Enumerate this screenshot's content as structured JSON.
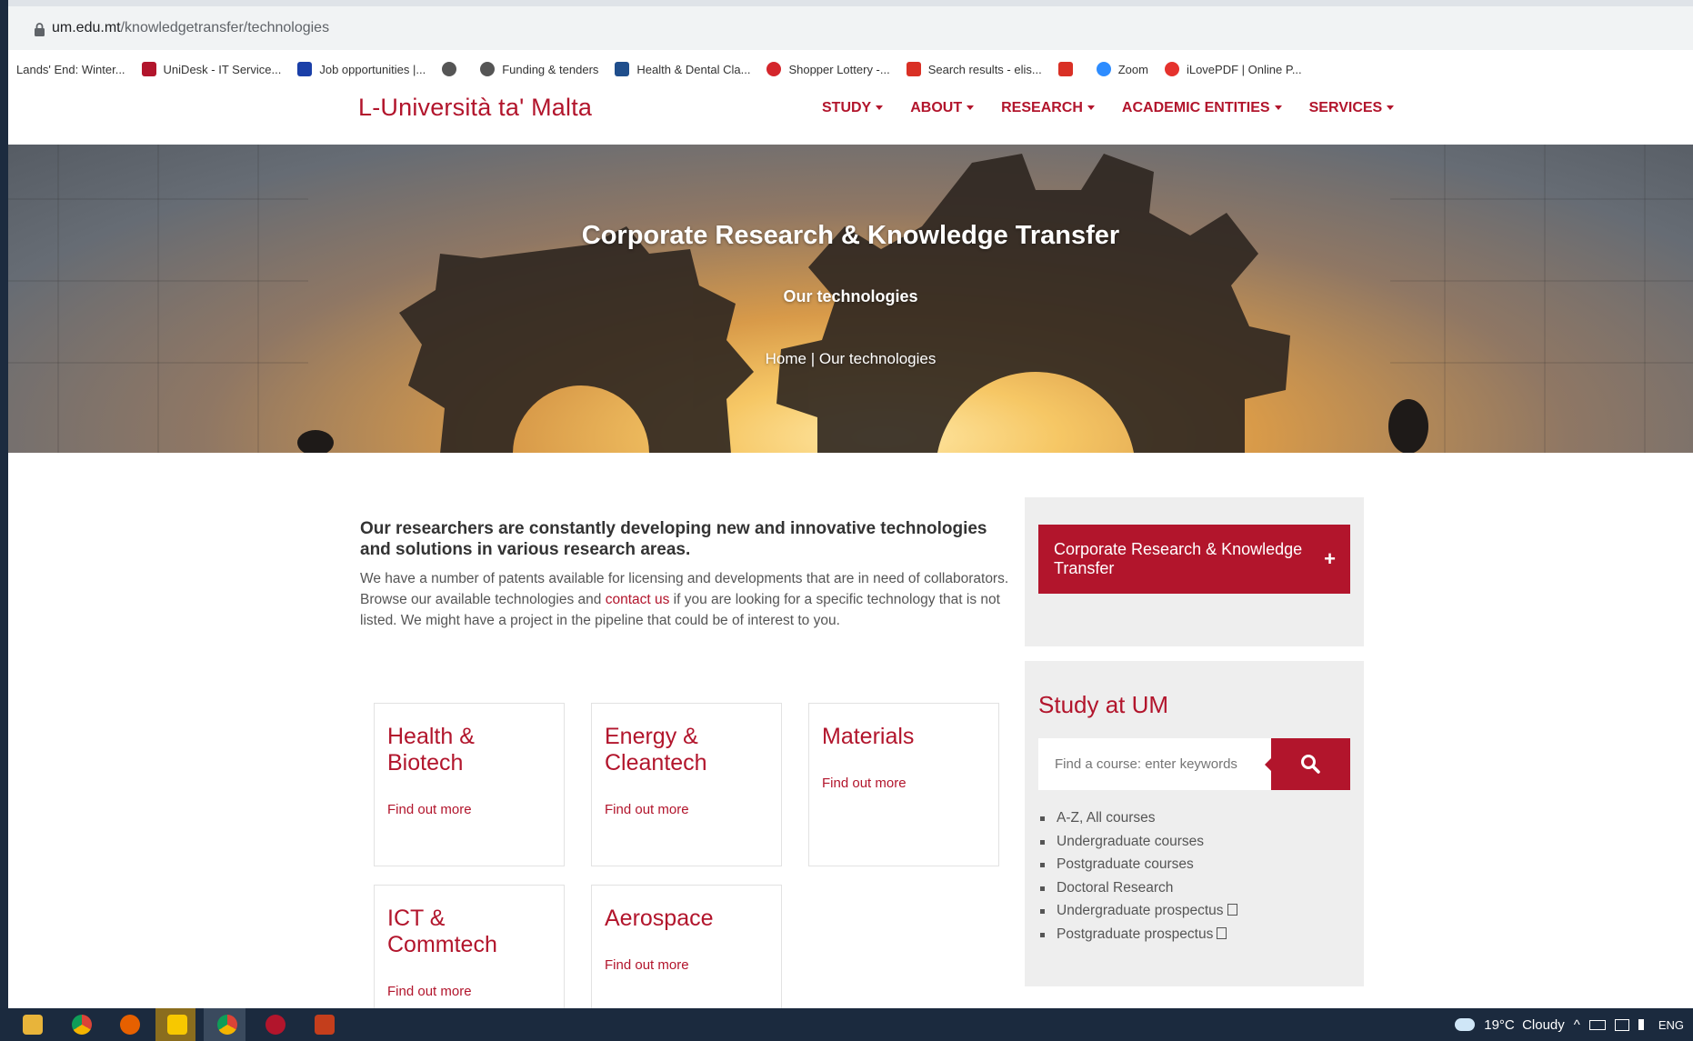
{
  "browser": {
    "url_domain": "um.edu.mt",
    "url_path": "/knowledgetransfer/technologies",
    "bookmarks": [
      {
        "label": "Lands' End: Winter...",
        "color": ""
      },
      {
        "label": "UniDesk - IT Service...",
        "color": "#b2152c"
      },
      {
        "label": "Job opportunities |...",
        "color": "#1a3fa8"
      },
      {
        "label": "",
        "color": "#555555"
      },
      {
        "label": "Funding & tenders",
        "color": "#555555"
      },
      {
        "label": "Health & Dental Cla...",
        "color": "#1f4e8c"
      },
      {
        "label": "Shopper Lottery -...",
        "color": "#d4262c"
      },
      {
        "label": "Search results - elis...",
        "color": "#d93025"
      },
      {
        "label": "",
        "color": "#d93025"
      },
      {
        "label": "Zoom",
        "color": "#2d8cff"
      },
      {
        "label": "iLovePDF | Online P...",
        "color": "#e5322d"
      }
    ]
  },
  "header": {
    "logo": "L-Università ta' Malta",
    "nav": [
      "STUDY",
      "ABOUT",
      "RESEARCH",
      "ACADEMIC ENTITIES",
      "SERVICES"
    ]
  },
  "hero": {
    "title": "Corporate Research & Knowledge Transfer",
    "subtitle": "Our technologies",
    "breadcrumb_home": "Home",
    "breadcrumb_sep": " | ",
    "breadcrumb_current": "Our technologies"
  },
  "intro": {
    "heading": "Our researchers are constantly developing new and innovative technologies and solutions in various research areas.",
    "body_before": "We have a number of patents available for licensing and developments that are in need of collaborators. Browse our available technologies and ",
    "body_link": "contact us",
    "body_after": " if you are looking for a specific technology that is not listed. We might have a project in the pipeline that could be of interest to you."
  },
  "cards": [
    {
      "title": "Health & Biotech",
      "link": "Find out more"
    },
    {
      "title": "Energy & Cleantech",
      "link": "Find out more"
    },
    {
      "title": "Materials",
      "link": "Find out more"
    },
    {
      "title": "ICT & Commtech",
      "link": "Find out more"
    },
    {
      "title": "Aerospace",
      "link": "Find out more"
    }
  ],
  "sidebar": {
    "menu_button": "Corporate Research & Knowledge Transfer",
    "menu_plus": "+",
    "study_title": "Study at UM",
    "search_placeholder": "Find a course: enter keywords",
    "links": [
      "A-Z, All courses",
      "Undergraduate courses",
      "Postgraduate courses",
      "Doctoral Research",
      "Undergraduate prospectus",
      "Postgraduate prospectus"
    ]
  },
  "taskbar": {
    "weather": "19°C  Cloudy",
    "language": "ENG"
  },
  "colors": {
    "brand": "#b2152c"
  }
}
